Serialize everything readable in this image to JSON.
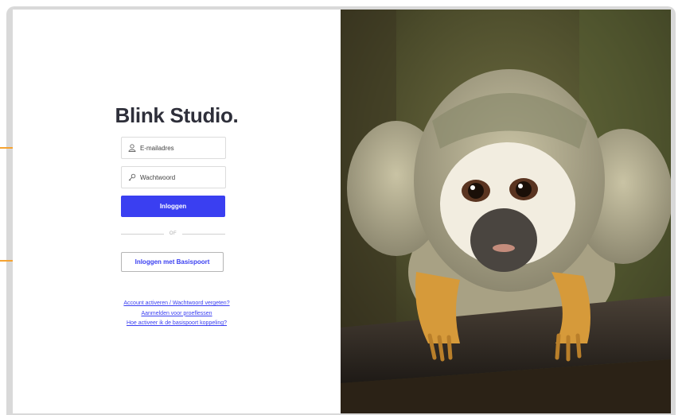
{
  "brand": {
    "title": "Blink Studio."
  },
  "form": {
    "email_placeholder": "E-mailadres",
    "password_placeholder": "Wachtwoord",
    "login_button": "Inloggen",
    "divider_text": "OF",
    "basispoort_button": "Inloggen met Basispoort"
  },
  "links": [
    {
      "label": "Account activeren / Wachtwoord vergeten?"
    },
    {
      "label": "Aanmelden voor proeflessen"
    },
    {
      "label": "Hoe activeer ik de basispoort koppeling?"
    }
  ],
  "icons": {
    "email": "user-icon",
    "password": "key-icon",
    "annotation": "arrow-right-icon"
  },
  "colors": {
    "primary": "#3a3ff1",
    "arrow": "#f5a332",
    "brand_text": "#2e2f3a",
    "frame": "#d9d9d9"
  }
}
